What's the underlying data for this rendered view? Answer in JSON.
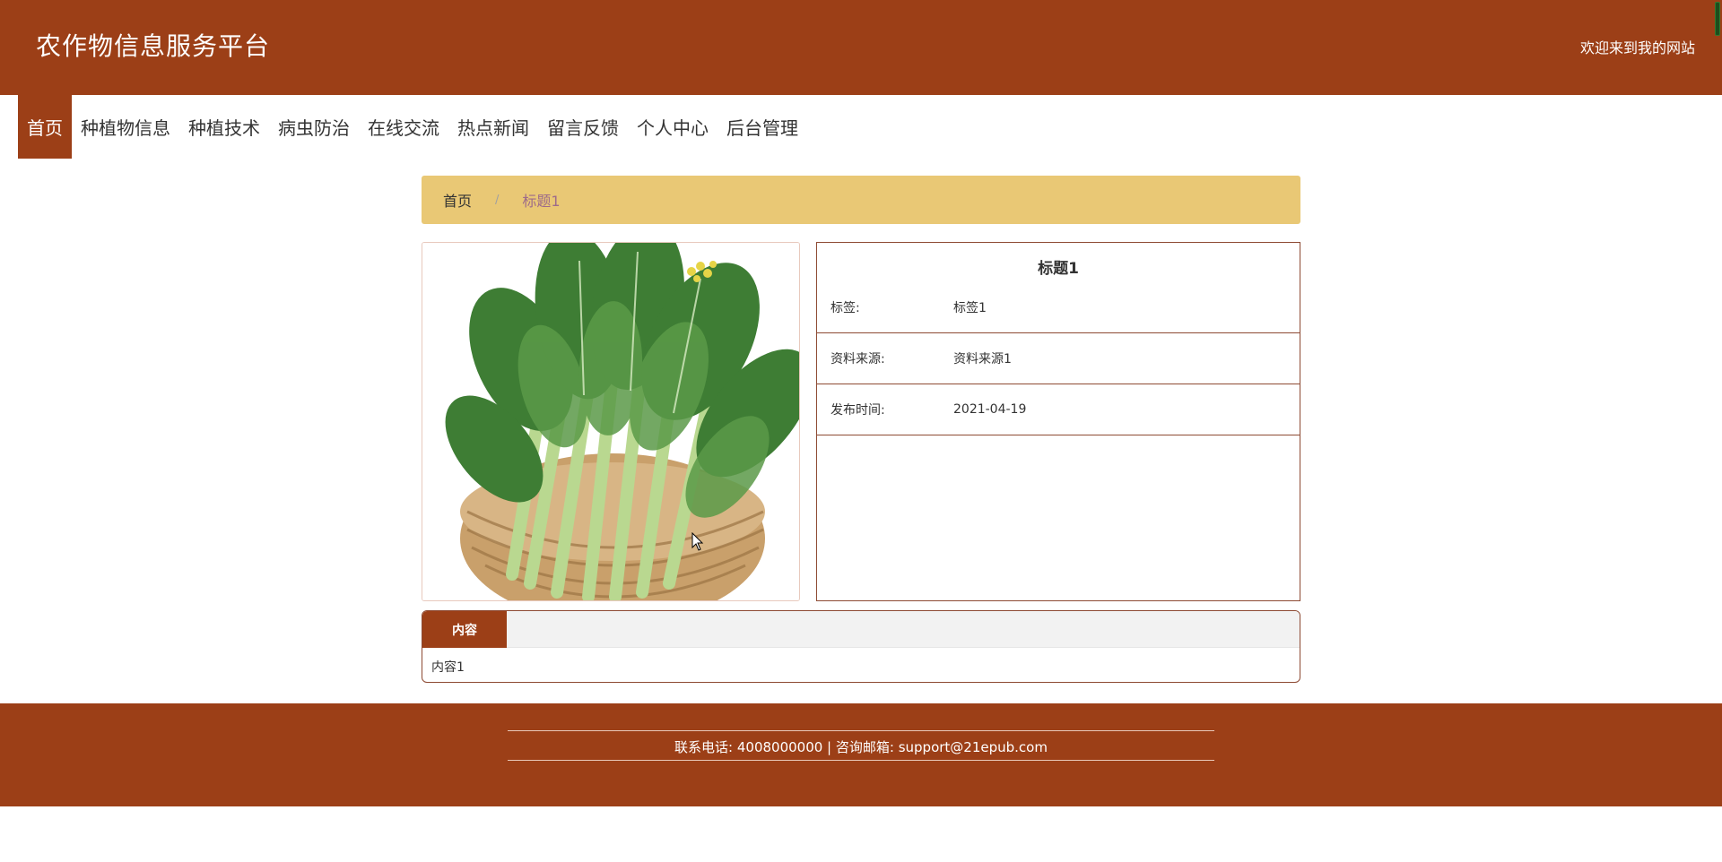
{
  "header": {
    "site_title": "农作物信息服务平台",
    "welcome": "欢迎来到我的网站"
  },
  "nav": {
    "items": [
      {
        "label": "首页",
        "active": true
      },
      {
        "label": "种植物信息"
      },
      {
        "label": "种植技术"
      },
      {
        "label": "病虫防治"
      },
      {
        "label": "在线交流"
      },
      {
        "label": "热点新闻"
      },
      {
        "label": "留言反馈"
      },
      {
        "label": "个人中心"
      },
      {
        "label": "后台管理"
      }
    ]
  },
  "breadcrumb": {
    "home": "首页",
    "separator": "/",
    "current": "标题1"
  },
  "detail": {
    "title": "标题1",
    "fields": [
      {
        "label": "标签:",
        "value": "标签1"
      },
      {
        "label": "资料来源:",
        "value": "资料来源1"
      },
      {
        "label": "发布时间:",
        "value": "2021-04-19"
      }
    ]
  },
  "content": {
    "tab_label": "内容",
    "body": "内容1"
  },
  "footer": {
    "text": "联系电话: 4008000000 | 咨询邮箱: support@21epub.com"
  },
  "colors": {
    "brand": "#9c3f17",
    "breadcrumb_bg": "#e9c875",
    "border": "#8d4a33"
  }
}
